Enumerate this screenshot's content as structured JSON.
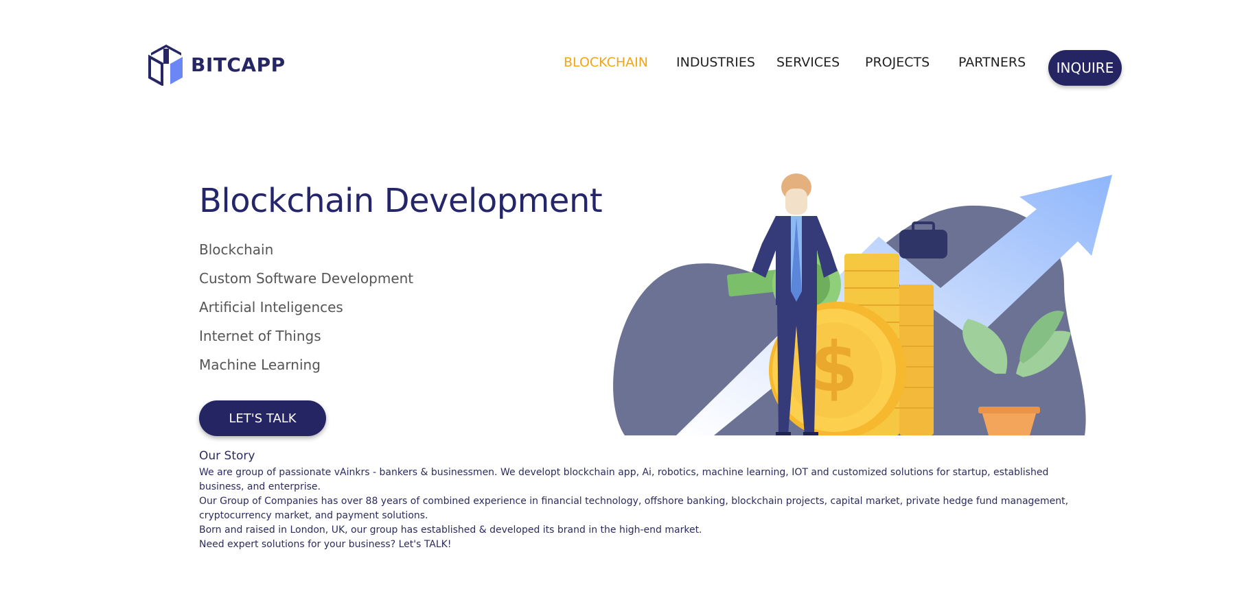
{
  "brand": {
    "name": "BITCAPP"
  },
  "nav": {
    "items": [
      {
        "label": "BLOCKCHAIN",
        "active": true
      },
      {
        "label": "INDUSTRIES",
        "active": false
      },
      {
        "label": "SERVICES",
        "active": false
      },
      {
        "label": "PROJECTS",
        "active": false
      },
      {
        "label": "PARTNERS",
        "active": false
      }
    ],
    "cta_label": "INQUIRE"
  },
  "hero": {
    "title": "Blockchain Development",
    "services": [
      "Blockchain",
      "Custom Software Development",
      "Artificial Inteligences",
      "Internet of Things",
      "Machine Learning"
    ],
    "cta_label": "LET'S TALK"
  },
  "story": {
    "title": "Our Story",
    "paragraphs": [
      "We are group of passionate vAinkrs - bankers & businessmen. We developt blockchain app, Ai, robotics, machine learning, IOT and customized solutions for startup, established business, and enterprise.",
      "Our Group of Companies has over 88 years of combined experience in financial technology, offshore banking, blockchain projects, capital market, private hedge fund management, cryptocurrency market, and payment solutions.",
      "Born and raised in London, UK, our group has established & developed its brand in the high-end market.",
      "Need expert solutions for your business? Let's TALK!"
    ]
  },
  "colors": {
    "navy": "#252563",
    "accent": "#f2a516",
    "blob": "#6b7293",
    "arrow": "#a9c8fb",
    "coin": "#fcd04e"
  },
  "icons": {
    "logo": "cube-logo-icon"
  }
}
